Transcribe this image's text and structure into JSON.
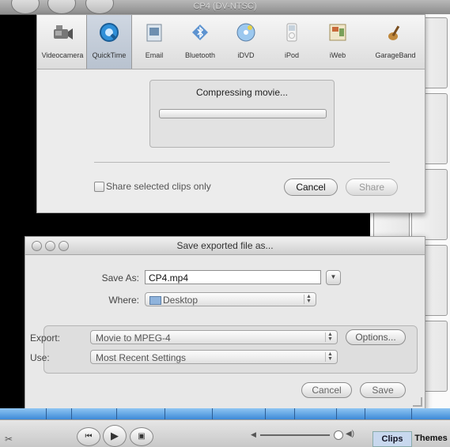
{
  "window": {
    "title": "CP4 (DV-NTSC)"
  },
  "share_sheet": {
    "tabs": [
      {
        "label": "Videocamera",
        "icon": "videocamera-icon",
        "selected": false
      },
      {
        "label": "QuickTime",
        "icon": "quicktime-icon",
        "selected": true
      },
      {
        "label": "Email",
        "icon": "email-icon",
        "selected": false
      },
      {
        "label": "Bluetooth",
        "icon": "bluetooth-icon",
        "selected": false
      },
      {
        "label": "iDVD",
        "icon": "idvd-icon",
        "selected": false
      },
      {
        "label": "iPod",
        "icon": "ipod-icon",
        "selected": false
      },
      {
        "label": "iWeb",
        "icon": "iweb-icon",
        "selected": false
      },
      {
        "label": "GarageBand",
        "icon": "garageband-icon",
        "selected": false
      }
    ],
    "progress_message": "Compressing movie...",
    "progress_fraction": 0,
    "share_selected_clips_label": "Share selected clips only",
    "share_selected_clips_checked": false,
    "cancel_label": "Cancel",
    "share_label": "Share"
  },
  "save_dialog": {
    "title": "Save exported file as...",
    "save_as_label": "Save As:",
    "save_as_value": "CP4.mp4",
    "where_label": "Where:",
    "where_value": "Desktop",
    "export_label": "Export:",
    "export_value": "Movie to MPEG-4",
    "options_label": "Options...",
    "use_label": "Use:",
    "use_value": "Most Recent Settings",
    "cancel_label": "Cancel",
    "save_label": "Save"
  },
  "bottom_bar": {
    "clips_label": "Clips",
    "themes_label": "Themes"
  },
  "colors": {
    "timeline_blue": "#4a94dc",
    "selected_tab": "#c3ccd8",
    "window_bg": "#ececec"
  }
}
